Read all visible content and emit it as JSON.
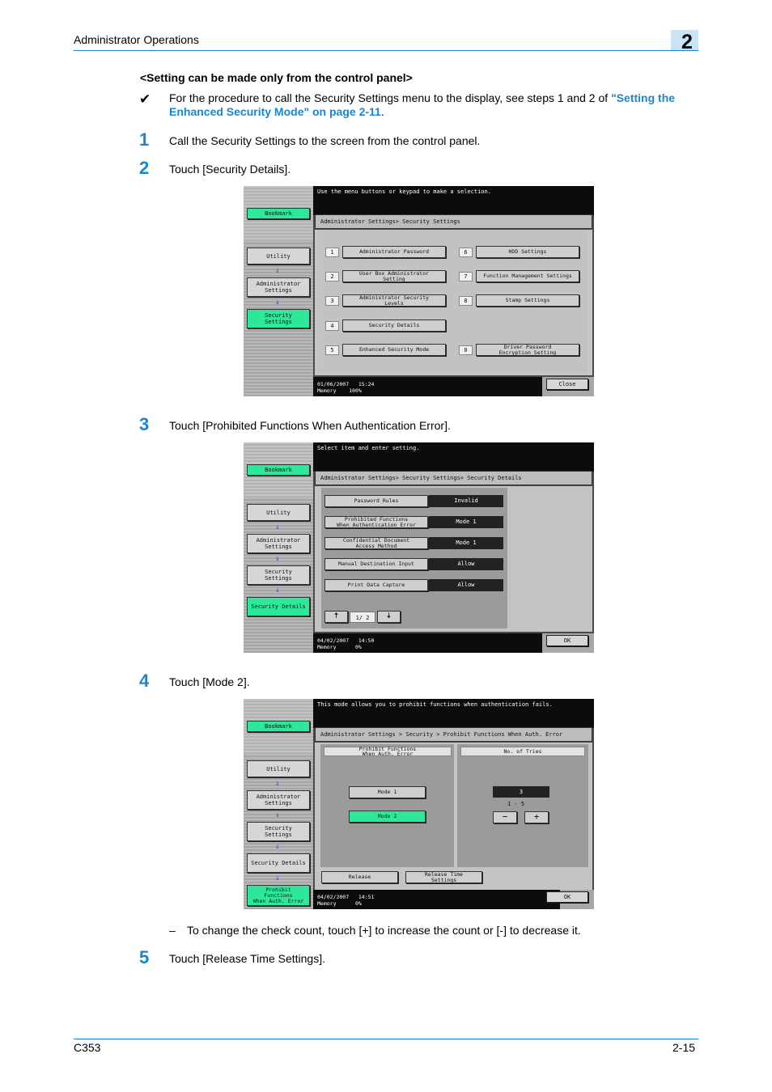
{
  "header": {
    "title": "Administrator Operations",
    "chapter": "2"
  },
  "heading": "<Setting can be made only from the control panel>",
  "note": {
    "check": "✔",
    "text": "For the procedure to call the Security Settings menu to the display, see steps 1 and 2 of ",
    "link": "\"Setting the Enhanced Security Mode\" on page 2-11",
    "end": "."
  },
  "steps": [
    {
      "num": "1",
      "text": "Call the Security Settings to the screen from the control panel."
    },
    {
      "num": "2",
      "text": "Touch [Security Details]."
    },
    {
      "num": "3",
      "text": "Touch [Prohibited Functions When Authentication Error]."
    },
    {
      "num": "4",
      "text": "Touch [Mode 2]."
    },
    {
      "num": "5",
      "text": "Touch [Release Time Settings]."
    }
  ],
  "dash_note": {
    "dash": "–",
    "text": "To change the check count, touch [+] to increase the count or [-] to decrease it."
  },
  "screen1": {
    "message": "Use the menu buttons or keypad to make a selection.",
    "path": "Administrator Settings> Security Settings",
    "sidebar": [
      "Bookmark",
      "Utility",
      "Administrator\nSettings",
      "Security\nSettings"
    ],
    "menu": [
      {
        "n": "1",
        "label": "Administrator Password"
      },
      {
        "n": "2",
        "label": "User Box Administrator\nSetting"
      },
      {
        "n": "3",
        "label": "Administrator Security\nLevels"
      },
      {
        "n": "4",
        "label": "Security Details"
      },
      {
        "n": "5",
        "label": "Enhanced Security Mode"
      },
      {
        "n": "6",
        "label": "HDD Settings"
      },
      {
        "n": "7",
        "label": "Function Management Settings"
      },
      {
        "n": "8",
        "label": "Stamp Settings"
      },
      {
        "n": "0",
        "label": "Driver Password\nEncryption Setting"
      }
    ],
    "status": {
      "date": "01/06/2007",
      "time": "15:24",
      "mem_label": "Memory",
      "mem": "100%"
    },
    "button": "Close"
  },
  "screen2": {
    "message": "Select item and enter setting.",
    "path": "Administrator Settings> Security Settings> Security Details",
    "sidebar": [
      "Bookmark",
      "Utility",
      "Administrator\nSettings",
      "Security\nSettings",
      "Security Details"
    ],
    "items": [
      {
        "label": "Password Rules",
        "value": "Invalid"
      },
      {
        "label": "Prohibited Functions\nWhen Authentication Error",
        "value": "Mode 1"
      },
      {
        "label": "Confidential Document\nAccess Method",
        "value": "Mode 1"
      },
      {
        "label": "Manual Destination Input",
        "value": "Allow"
      },
      {
        "label": "Print Data Capture",
        "value": "Allow"
      }
    ],
    "page": "1/ 2",
    "status": {
      "date": "04/02/2007",
      "time": "14:50",
      "mem_label": "Memory",
      "mem": "0%"
    },
    "button": "OK"
  },
  "screen3": {
    "message": "This mode allows you to prohibit functions when authentication fails.",
    "path": "Administrator Settings > Security > Prohibit Functions When Auth. Error",
    "sidebar": [
      "Bookmark",
      "Utility",
      "Administrator\nSettings",
      "Security\nSettings",
      "Security Details",
      "Prohibit\nFunctions\nWhen Auth. Error"
    ],
    "left_title": "Prohibit Functions\nWhen Auth. Error",
    "mode1": "Mode 1",
    "mode2": "Mode 2",
    "right_title": "No. of Tries",
    "tries": "3",
    "range": "1  -  5",
    "minus": "−",
    "plus": "+",
    "release": "Release",
    "release_time": "Release Time\nSettings",
    "status": {
      "date": "04/02/2007",
      "time": "14:51",
      "mem_label": "Memory",
      "mem": "0%"
    },
    "button": "OK"
  },
  "footer": {
    "model": "C353",
    "page": "2-15"
  }
}
